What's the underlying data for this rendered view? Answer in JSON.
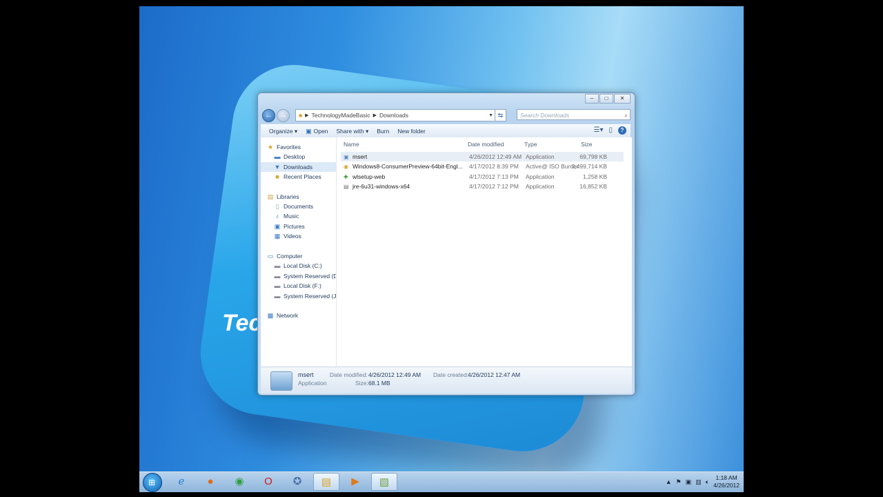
{
  "window": {
    "caption_buttons": [
      "–",
      "□",
      "✕"
    ],
    "breadcrumb": [
      "TechnologyMadeBasic",
      "Downloads"
    ],
    "search_placeholder": "Search Downloads"
  },
  "toolbar": {
    "organize": "Organize ▾",
    "open": "Open",
    "share": "Share with ▾",
    "burn": "Burn",
    "new_folder": "New folder"
  },
  "nav": {
    "favorites": "Favorites",
    "desktop": "Desktop",
    "downloads": "Downloads",
    "recent": "Recent Places",
    "libraries": "Libraries",
    "documents": "Documents",
    "music": "Music",
    "pictures": "Pictures",
    "videos": "Videos",
    "computer": "Computer",
    "disk_c": "Local Disk (C:)",
    "reserved_d": "System Reserved (D:",
    "disk_f": "Local Disk (F:)",
    "reserved_j": "System Reserved (J:)",
    "network": "Network"
  },
  "columns": {
    "name": "Name",
    "date": "Date modified",
    "type": "Type",
    "size": "Size"
  },
  "files": [
    {
      "name": "msert",
      "date": "4/26/2012 12:49 AM",
      "type": "Application",
      "size": "69,798 KB"
    },
    {
      "name": "Windows8-ConsumerPreview-64bit-Engl...",
      "date": "4/17/2012 8:39 PM",
      "type": "Active@ ISO Burner",
      "size": "3,499,714 KB"
    },
    {
      "name": "wlsetup-web",
      "date": "4/17/2012 7:13 PM",
      "type": "Application",
      "size": "1,258 KB"
    },
    {
      "name": "jre-6u31-windows-x64",
      "date": "4/17/2012 7:12 PM",
      "type": "Application",
      "size": "16,852 KB"
    }
  ],
  "details": {
    "name": "msert",
    "kind": "Application",
    "modified_label": "Date modified:",
    "modified": "4/26/2012 12:49 AM",
    "size_label": "Size:",
    "size": "68.1 MB",
    "created_label": "Date created:",
    "created": "4/26/2012 12:47 AM"
  },
  "wallpaper_text": "Tec",
  "taskbar": {
    "time": "1:18 AM",
    "date": "4/26/2012"
  }
}
